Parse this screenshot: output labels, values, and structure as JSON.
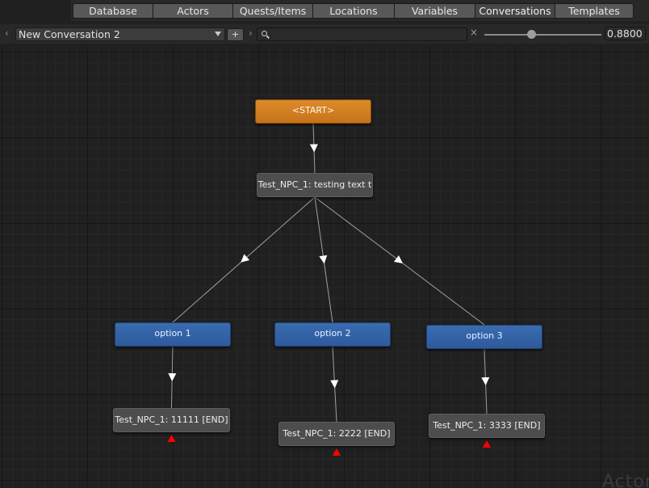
{
  "tabs": [
    {
      "label": "Database",
      "active": false
    },
    {
      "label": "Actors",
      "active": false
    },
    {
      "label": "Quests/Items",
      "active": false
    },
    {
      "label": "Locations",
      "active": false
    },
    {
      "label": "Variables",
      "active": false
    },
    {
      "label": "Conversations",
      "active": true
    },
    {
      "label": "Templates",
      "active": false
    }
  ],
  "toolbar": {
    "conversation_select": "New Conversation 2",
    "add_label": "+",
    "search_value": "",
    "zoom": 0.88,
    "zoom_text": "0.8800"
  },
  "nodes": {
    "start": "<START>",
    "npc_main": "Test_NPC_1: testing text t",
    "option1": "option 1",
    "option2": "option 2",
    "option3": "option 3",
    "end1": "Test_NPC_1: 11111 [END]",
    "end2": "Test_NPC_1: 2222 [END]",
    "end3": "Test_NPC_1: 3333 [END]"
  },
  "links": [
    [
      "start",
      "npc_main"
    ],
    [
      "npc_main",
      "option1"
    ],
    [
      "npc_main",
      "option2"
    ],
    [
      "npc_main",
      "option3"
    ],
    [
      "option1",
      "end1"
    ],
    [
      "option2",
      "end2"
    ],
    [
      "option3",
      "end3"
    ]
  ],
  "watermark": "Actor",
  "colors": {
    "start_node": "#d07c22",
    "npc_node": "#4d4d4d",
    "player_node": "#3363a8",
    "link": "#a0a0a0",
    "end_marker": "#ff0000"
  }
}
